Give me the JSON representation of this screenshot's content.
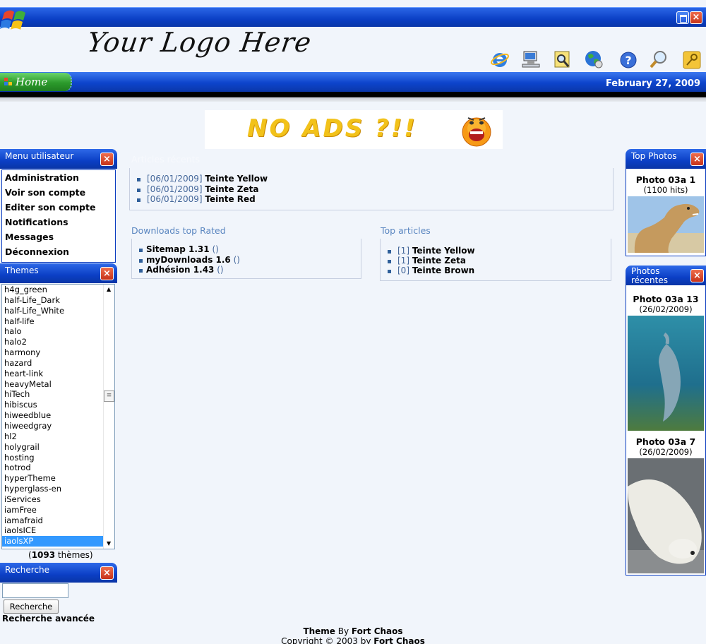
{
  "header": {
    "logo_text": "Your Logo Here",
    "home_label": "Home",
    "date": "February 27, 2009",
    "window_buttons": [
      "maximize-icon",
      "close-icon"
    ],
    "toolbar_icons": [
      "internet-explorer-icon",
      "network-computer-icon",
      "search-document-icon",
      "globe-icon",
      "help-icon",
      "magnifier-icon",
      "key-icon"
    ]
  },
  "ad": {
    "text": "NO ADS ?!!"
  },
  "left": {
    "menu": {
      "title": "Menu utilisateur",
      "items": [
        "Administration",
        "Voir son compte",
        "Editer son compte",
        "Notifications",
        "Messages",
        "Déconnexion"
      ]
    },
    "themes": {
      "title": "Themes",
      "options": [
        "h4g_green",
        "half-Life_Dark",
        "half-Life_White",
        "half-life",
        "halo",
        "halo2",
        "harmony",
        "hazard",
        "heart-link",
        "heavyMetal",
        "hiTech",
        "hibiscus",
        "hiweedblue",
        "hiweedgray",
        "hl2",
        "holygrail",
        "hosting",
        "hotrod",
        "hyperTheme",
        "hyperglass-en",
        "iServices",
        "iamFree",
        "iamafraid",
        "iaolsICE",
        "iaolsXP"
      ],
      "selected": "iaolsXP",
      "count_number": "1093",
      "count_suffix": " thèmes)",
      "count_prefix": "("
    },
    "search": {
      "title": "Recherche",
      "input_value": "",
      "button_label": "Recherche",
      "advanced_label": "Recherche avancée"
    }
  },
  "center": {
    "recent_articles": {
      "heading": "Articles récents",
      "items": [
        {
          "date": "[06/01/2009]",
          "title": "Teinte Yellow"
        },
        {
          "date": "[06/01/2009]",
          "title": "Teinte Zeta"
        },
        {
          "date": "[06/01/2009]",
          "title": "Teinte Red"
        }
      ]
    },
    "downloads": {
      "heading": "Downloads top Rated",
      "items": [
        {
          "name": "Sitemap 1.31",
          "extra": "()"
        },
        {
          "name": "myDownloads 1.6",
          "extra": "()"
        },
        {
          "name": "Adhésion 1.43",
          "extra": "()"
        }
      ]
    },
    "top_articles": {
      "heading": "Top articles",
      "items": [
        {
          "count": "[1]",
          "title": "Teinte Yellow"
        },
        {
          "count": "[1]",
          "title": "Teinte Zeta"
        },
        {
          "count": "[0]",
          "title": "Teinte Brown"
        }
      ]
    }
  },
  "right": {
    "top_photos": {
      "title": "Top Photos",
      "photo": {
        "name": "Photo 03a 1",
        "sub": "(1100 hits)"
      }
    },
    "recent_photos": {
      "title": "Photos récentes",
      "photos": [
        {
          "name": "Photo 03a 13",
          "sub": "(26/02/2009)"
        },
        {
          "name": "Photo 03a 7",
          "sub": "(26/02/2009)"
        }
      ]
    }
  },
  "footer": {
    "line1_prefix": "Theme",
    "line1_by": " By ",
    "line1_author": "Fort Chaos",
    "line2_prefix": "Copyright © 2003 by ",
    "line2_author": "Fort Chaos"
  },
  "colors": {
    "titlebar_blue": "#0b3fc5",
    "home_green": "#2c9a2c",
    "close_red": "#c6321a",
    "page_bg": "#f1f5fb",
    "selection": "#3399ff"
  }
}
